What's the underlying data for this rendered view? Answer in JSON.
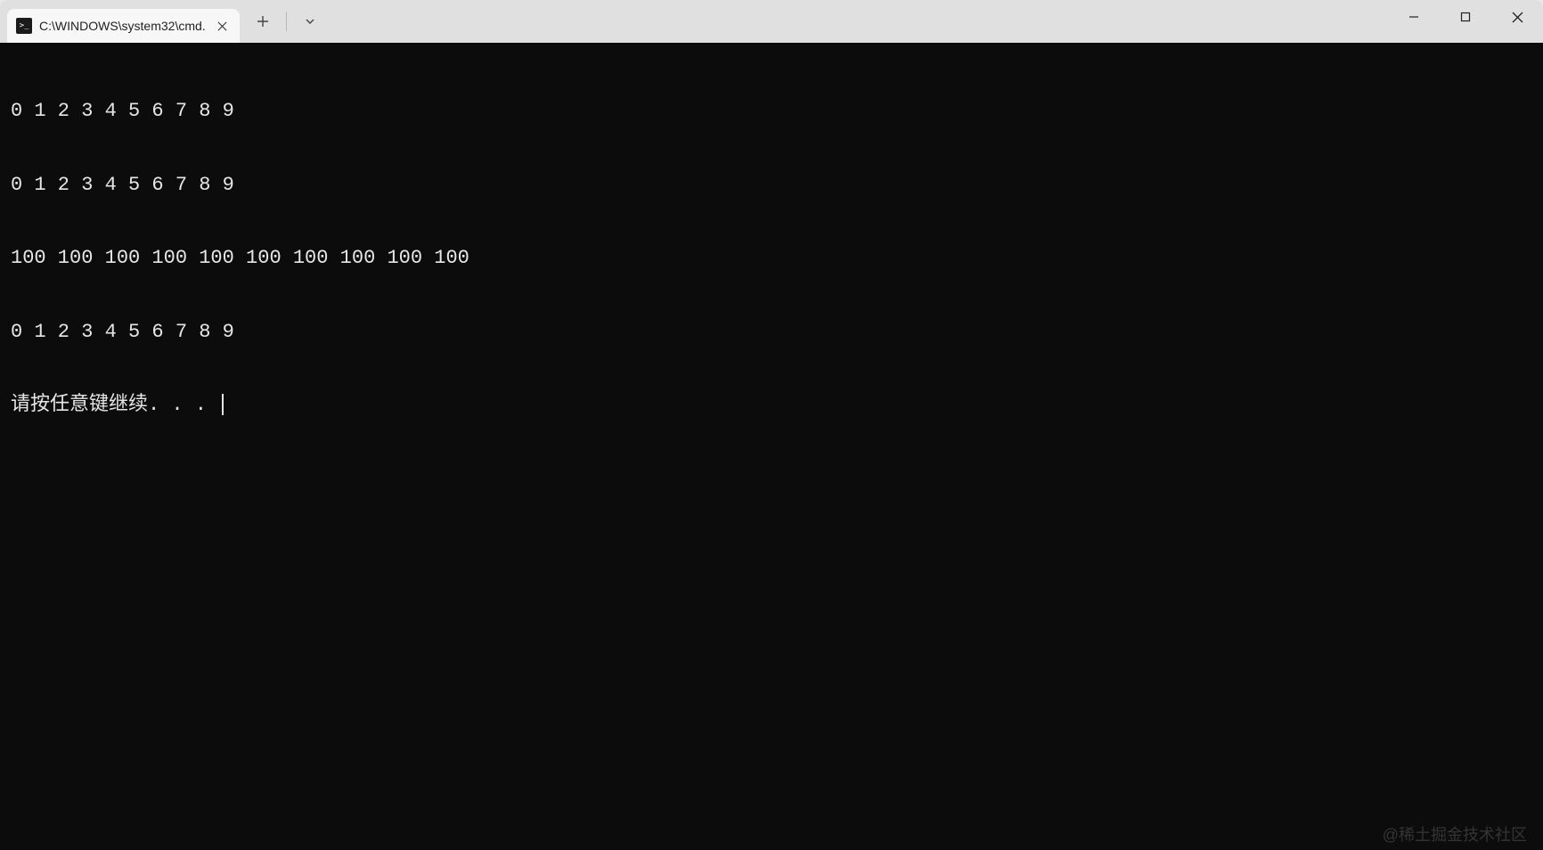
{
  "tab": {
    "title": "C:\\WINDOWS\\system32\\cmd."
  },
  "terminal": {
    "lines": [
      "0 1 2 3 4 5 6 7 8 9",
      "0 1 2 3 4 5 6 7 8 9",
      "100 100 100 100 100 100 100 100 100 100",
      "0 1 2 3 4 5 6 7 8 9",
      "请按任意键继续. . . "
    ]
  },
  "watermark": "@稀土掘金技术社区"
}
